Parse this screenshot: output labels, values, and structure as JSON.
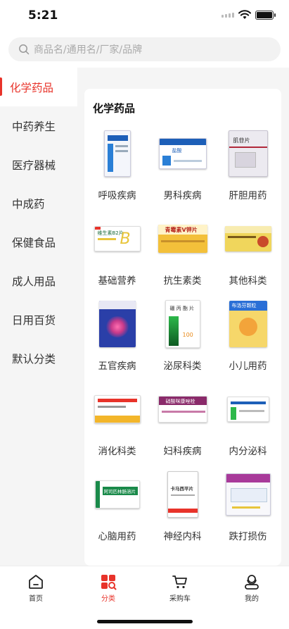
{
  "status_bar": {
    "time": "5:21"
  },
  "search": {
    "placeholder": "商品名/通用名/厂家/品牌"
  },
  "sidebar": {
    "items": [
      {
        "label": "化学药品",
        "active": true
      },
      {
        "label": "中药养生",
        "active": false
      },
      {
        "label": "医疗器械",
        "active": false
      },
      {
        "label": "中成药",
        "active": false
      },
      {
        "label": "保健食品",
        "active": false
      },
      {
        "label": "成人用品",
        "active": false
      },
      {
        "label": "日用百货",
        "active": false
      },
      {
        "label": "默认分类",
        "active": false
      }
    ]
  },
  "content": {
    "title": "化学药品",
    "categories": [
      {
        "label": "呼吸疾病"
      },
      {
        "label": "男科疾病",
        "box_text": "盐酸"
      },
      {
        "label": "肝胆用药",
        "box_text": "肌苷片"
      },
      {
        "label": "基础营养",
        "box_text": "维生素B2片"
      },
      {
        "label": "抗生素类",
        "box_text": "青霉素V钾片"
      },
      {
        "label": "其他科类"
      },
      {
        "label": "五官疾病"
      },
      {
        "label": "泌尿科类",
        "box_text": "硼 丙 酯 片"
      },
      {
        "label": "小儿用药",
        "box_text": "布洛芬颗粒"
      },
      {
        "label": "消化科类"
      },
      {
        "label": "妇科疾病",
        "box_text": "硝酸咪康唑栓"
      },
      {
        "label": "内分泌科"
      },
      {
        "label": "心脑用药",
        "box_text": "阿司匹林肠溶片"
      },
      {
        "label": "神经内科",
        "box_text": "卡马西平片"
      },
      {
        "label": "跌打损伤"
      }
    ]
  },
  "tabbar": {
    "items": [
      {
        "label": "首页",
        "icon": "home-icon",
        "active": false
      },
      {
        "label": "分类",
        "icon": "category-icon",
        "active": true
      },
      {
        "label": "采购车",
        "icon": "cart-icon",
        "active": false
      },
      {
        "label": "我的",
        "icon": "profile-icon",
        "active": false
      }
    ]
  },
  "colors": {
    "accent": "#e8332a",
    "background": "#f5f5f5"
  }
}
